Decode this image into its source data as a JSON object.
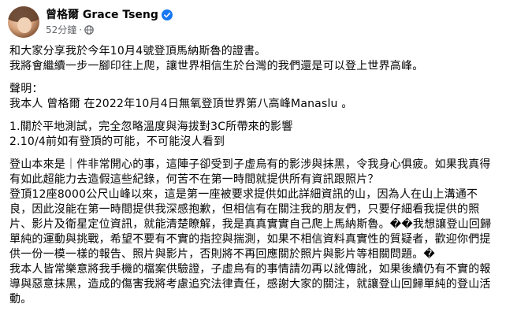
{
  "author": {
    "name": "曾格爾 Grace Tseng",
    "timestamp": "52分鐘",
    "verified_icon": "verified-badge-icon",
    "audience_icon": "globe-icon"
  },
  "post": {
    "intro": [
      "和大家分享我於今年10月4號登頂馬納斯魯的證書。",
      "我將會繼續一步一腳印往上爬，讓世界相信生於台灣的我們還是可以登上世界高峰。"
    ],
    "statement_title": "聲明：",
    "statement": "我本人 曾格爾 在2022年10月4日無氧登頂世界第八高峰Manaslu 。",
    "points": [
      "1.關於平地測試，完全忽略溫度與海拔對3C所帶來的影響",
      "2.10/4前如有登頂的可能，不可能沒人看到"
    ],
    "para1": [
      "登山本來是｜件非常開心的事，這陣子卻受到子虛烏有的影涉與抹黑，令我身心俱疲。如果我真得",
      "有如此超能力去造假這些紀錄，何苦不在第一時間就提供所有資訊跟照片？"
    ],
    "para2": [
      "登頂12座8000公尺山峰以來，這是第一座被要求提供如此詳細資訊的山，因為人在山上溝通不",
      "良，因此沒能在第一時間提供我深感抱歉，但相信有在關注我的朋友們，只要仔細看我提供的照",
      "片、影片及衛星定位資訊，就能清楚瞭解，我是真真實實自己爬上馬納斯魯。��我想讓登山回歸",
      "單純的運動與挑戰，希望不要有不實的指控與揣測，如果不相信資料真實性的質疑者，歡迎你們提",
      "供一份一模一樣的報告、照片與影片，否則將不再回應關於照片與影片等相關問題。�"
    ],
    "para3": [
      "我本人皆常樂意將我手機的檔案供驗證，子虛烏有的事情請勿再以訛傳訛，如果後續仍有不實的報",
      "導與惡意抹黑，造成的傷害我將考慮追究法律責任，感謝大家的關注，就讓登山回歸單純的登山活",
      "動。"
    ]
  },
  "colors": {
    "text": "#050505",
    "meta": "#65676b",
    "verified": "#1877f2",
    "background": "#ffffff"
  }
}
